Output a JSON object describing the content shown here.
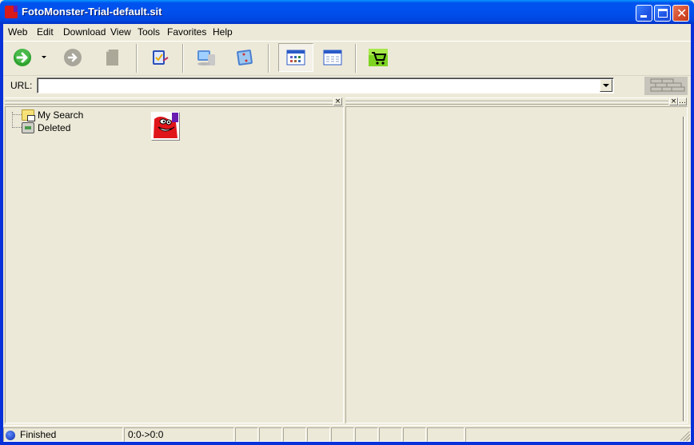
{
  "window": {
    "title": "FotoMonster-Trial-default.sit",
    "controls": {
      "minimize": "minimize",
      "maximize": "maximize",
      "close": "close"
    }
  },
  "menubar": {
    "items": [
      {
        "label": "Web"
      },
      {
        "label": "Edit"
      },
      {
        "label": "Download"
      },
      {
        "label": "View"
      },
      {
        "label": "Tools"
      },
      {
        "label": "Favorites"
      },
      {
        "label": "Help"
      }
    ]
  },
  "toolbar": {
    "buttons": [
      {
        "icon": "go-arrow-icon",
        "enabled": true
      },
      {
        "icon": "dropdown-arrow-icon",
        "enabled": true
      },
      {
        "icon": "forward-arrow-icon",
        "enabled": false
      },
      {
        "icon": "page-icon",
        "enabled": false
      },
      {
        "icon": "checklist-icon",
        "enabled": true
      },
      {
        "icon": "computer-icon",
        "enabled": true
      },
      {
        "icon": "picture-icon",
        "enabled": true
      },
      {
        "icon": "thumbnail-view-icon",
        "enabled": true,
        "pressed": true
      },
      {
        "icon": "list-view-icon",
        "enabled": true
      },
      {
        "icon": "shopping-cart-icon",
        "enabled": true
      }
    ]
  },
  "urlbar": {
    "label": "URL:",
    "value": "",
    "placeholder": ""
  },
  "tree": {
    "items": [
      {
        "label": "My Search",
        "icon": "search-folder-icon"
      },
      {
        "label": "Deleted",
        "icon": "recycle-bin-icon"
      }
    ]
  },
  "panes": {
    "left_close": "×",
    "right_close": "×"
  },
  "statusbar": {
    "status": "Finished",
    "range": "0:0->0:0",
    "extra_panels": [
      "",
      "",
      "",
      "",
      "",
      "",
      "",
      "",
      "",
      ""
    ]
  }
}
